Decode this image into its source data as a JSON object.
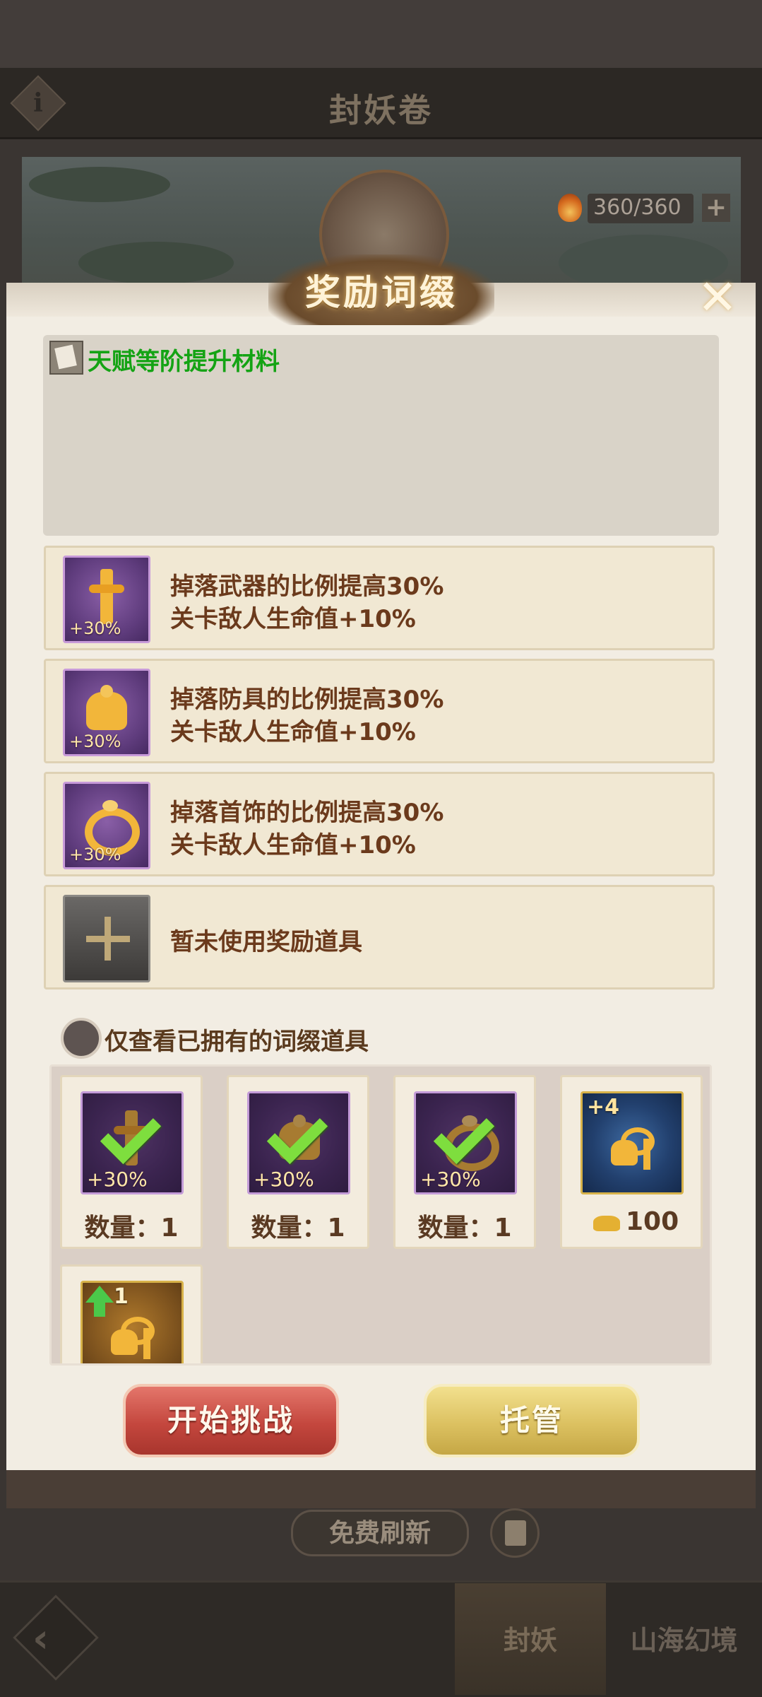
{
  "background": {
    "title": "封妖卷",
    "info_icon": "i",
    "energy": "360/360",
    "energy_plus": "+",
    "refresh_label": "免费刷新",
    "nav": {
      "back_icon": "‹",
      "tab1": "封妖",
      "tab2": "山海幻境"
    }
  },
  "dialog": {
    "title": "奖励词缀",
    "close_glyph": "✕",
    "material_label": "天赋等阶提升材料",
    "rows": [
      {
        "line1": "掉落武器的比例提高30%",
        "line2": "关卡敌人生命值+10%",
        "badge": "+30%",
        "icon": "sword-icon"
      },
      {
        "line1": "掉落防具的比例提高30%",
        "line2": "关卡敌人生命值+10%",
        "badge": "+30%",
        "icon": "armor-icon"
      },
      {
        "line1": "掉落首饰的比例提高30%",
        "line2": "关卡敌人生命值+10%",
        "badge": "+30%",
        "icon": "ring-icon"
      },
      {
        "line1": "暂未使用奖励道具",
        "icon": "plus-icon"
      }
    ],
    "filter_label": "仅查看已拥有的词缀道具",
    "inventory": [
      {
        "badge": "+30%",
        "qty": "数量：1",
        "icon": "sword-icon",
        "selected": true
      },
      {
        "badge": "+30%",
        "qty": "数量：1",
        "icon": "armor-icon",
        "selected": true
      },
      {
        "badge": "+30%",
        "qty": "数量：1",
        "icon": "ring-icon",
        "selected": true
      },
      {
        "badge": "+4",
        "price": "100",
        "icon": "equipment-bundle-icon",
        "currency_icon": "gold-ingot-icon"
      },
      {
        "badge": "1",
        "icon": "equipment-bundle-icon",
        "upgrade_icon": "green-up-arrow-icon"
      }
    ],
    "buttons": {
      "start": "开始挑战",
      "auto": "托管"
    }
  },
  "colors": {
    "accent_green": "#14a314",
    "start_button": "#c4473e",
    "auto_button": "#dcc161",
    "text_brown": "#6b3a1c"
  }
}
